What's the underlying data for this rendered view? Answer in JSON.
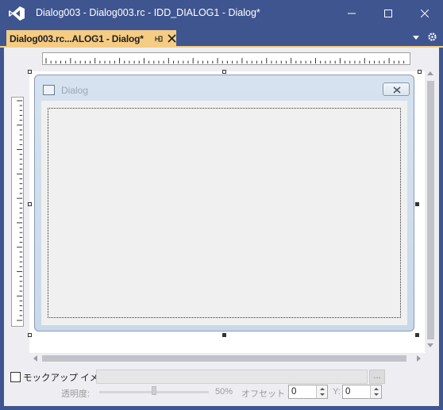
{
  "window": {
    "title": "Dialog003 - Dialog003.rc - IDD_DIALOG1 - Dialog*",
    "minimize_icon": "minimize-icon",
    "maximize_icon": "maximize-icon",
    "close_icon": "close-icon"
  },
  "tab": {
    "label": "Dialog003.rc...ALOG1 - Dialog*",
    "pin_icon": "pin-icon",
    "close_icon": "close-icon",
    "color": "#f5cc84"
  },
  "dialog": {
    "title": "Dialog"
  },
  "mockup": {
    "checkbox_label": "モックアップ イメージ",
    "checked": false,
    "path_value": "",
    "browse_label": "...",
    "transparency_label": "透明度:",
    "transparency_percent": "50%",
    "transparency_value": 50,
    "offset_label": "オフセット X:",
    "offset_x": "0",
    "y_label": "Y:",
    "offset_y": "0"
  },
  "colors": {
    "titlebar": "#3f5590",
    "tab_active": "#f5cc84",
    "editor_bg": "#eeeef2"
  }
}
